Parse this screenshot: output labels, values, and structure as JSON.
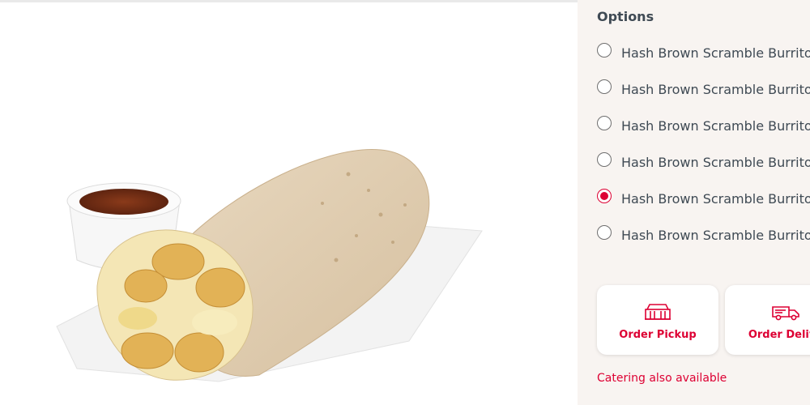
{
  "options": {
    "title": "Options",
    "items": [
      {
        "label": "Hash Brown Scramble Burrito w",
        "selected": false
      },
      {
        "label": "Hash Brown Scramble Burrito w",
        "selected": false
      },
      {
        "label": "Hash Brown Scramble Burrito w",
        "selected": false
      },
      {
        "label": "Hash Brown Scramble Burrito w",
        "selected": false
      },
      {
        "label": "Hash Brown Scramble Burrito w",
        "selected": true
      },
      {
        "label": "Hash Brown Scramble Burrito w",
        "selected": false
      }
    ]
  },
  "actions": {
    "pickup_label": "Order Pickup",
    "pickup_icon": "storefront-icon",
    "delivery_label": "Order Delive",
    "delivery_icon": "delivery-truck-icon"
  },
  "catering_text": "Catering also available",
  "colors": {
    "accent": "#dd0033",
    "panel_bg": "#f8f4f1",
    "text": "#3f4a54"
  }
}
